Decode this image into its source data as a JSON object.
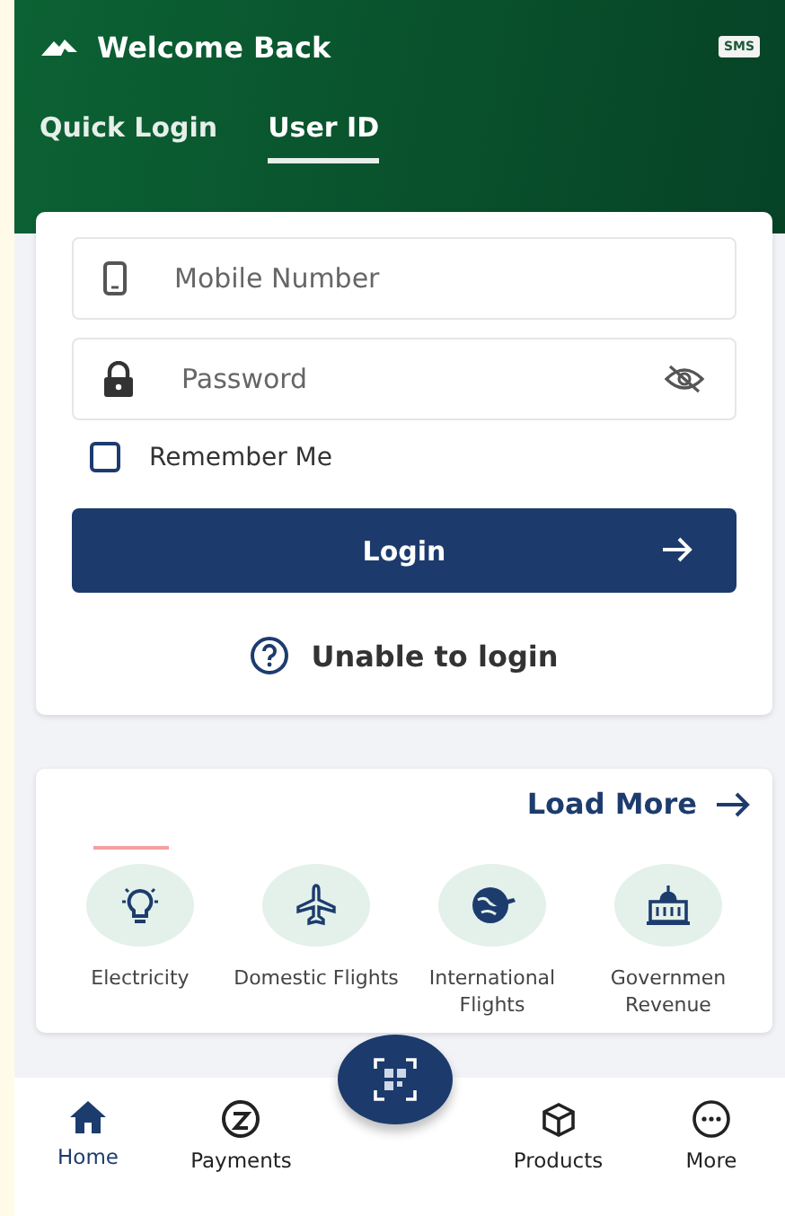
{
  "header": {
    "title": "Welcome Back",
    "sms_badge": "SMS"
  },
  "tabs": [
    {
      "label": "Quick Login",
      "selected": false
    },
    {
      "label": "User ID",
      "selected": true
    }
  ],
  "login_form": {
    "mobile": {
      "placeholder": "Mobile Number"
    },
    "password": {
      "placeholder": "Password"
    },
    "remember": {
      "label": "Remember Me",
      "checked": false
    },
    "login_button": "Login",
    "help_link": "Unable to login"
  },
  "services": {
    "load_more": "Load More",
    "items": [
      {
        "kind": "bulb",
        "label": "Electricity"
      },
      {
        "kind": "plane",
        "label": "Domestic Flights"
      },
      {
        "kind": "globe",
        "label": "International Flights"
      },
      {
        "kind": "building",
        "label": "Governmen Revenue"
      }
    ]
  },
  "bottom_nav": [
    {
      "kind": "home",
      "label": "Home",
      "selected": true
    },
    {
      "kind": "payments",
      "label": "Payments",
      "selected": false
    },
    {
      "kind": "products",
      "label": "Products",
      "selected": false
    },
    {
      "kind": "more",
      "label": "More",
      "selected": false
    }
  ]
}
